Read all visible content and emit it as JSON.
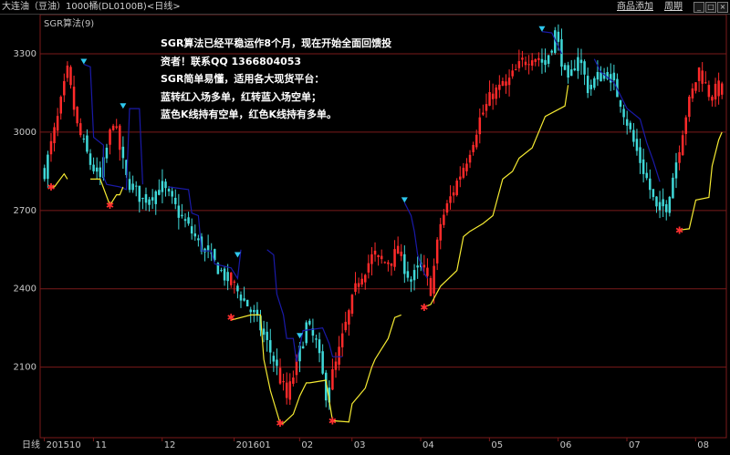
{
  "window": {
    "title": "大连油（豆油）1000桶(DL0100B)<日线>",
    "buttons": {
      "add": "商品添加",
      "period": "周期"
    },
    "winbtns": [
      "_",
      "□",
      "×"
    ]
  },
  "indicator_label": "SGR算法(9)",
  "annotation": [
    "SGR算法已经平稳运作8个月，现在开始全面回馈投",
    "资者！联系QQ 1366804053",
    "SGR简单易懂，适用各大现货平台：",
    "蓝转红入场多单，红转蓝入场空单；",
    "蓝色K线持有空单，红色K线持有多单。"
  ],
  "colors": {
    "up": "#ff2a2a",
    "down": "#3fd8d8",
    "stop_line_down": "#1a1aa8",
    "stop_line_up": "#f5ea32",
    "marker_down": "#2ec8ee",
    "marker_up": "#ff3030",
    "grid": "#7a1a1a",
    "axis": "#7a1a1a"
  },
  "chart_data": {
    "type": "candlestick",
    "y_ticks": [
      2100,
      2400,
      2700,
      3000,
      3300
    ],
    "ylim": [
      1830,
      3450
    ],
    "x_labels": [
      {
        "label": "日线",
        "index": -3
      },
      {
        "label": "201510",
        "index": 1
      },
      {
        "label": "11",
        "index": 16
      },
      {
        "label": "12",
        "index": 37
      },
      {
        "label": "201601",
        "index": 59
      },
      {
        "label": "02",
        "index": 79
      },
      {
        "label": "03",
        "index": 95
      },
      {
        "label": "04",
        "index": 116
      },
      {
        "label": "05",
        "index": 137
      },
      {
        "label": "06",
        "index": 158
      },
      {
        "label": "07",
        "index": 179
      },
      {
        "label": "08",
        "index": 200
      }
    ],
    "anchors": [
      [
        0,
        2850
      ],
      [
        4,
        3050
      ],
      [
        7,
        3230
      ],
      [
        10,
        3020
      ],
      [
        14,
        2880
      ],
      [
        17,
        2820
      ],
      [
        21,
        3050
      ],
      [
        25,
        2820
      ],
      [
        30,
        2740
      ],
      [
        36,
        2790
      ],
      [
        42,
        2670
      ],
      [
        48,
        2560
      ],
      [
        55,
        2450
      ],
      [
        61,
        2360
      ],
      [
        66,
        2250
      ],
      [
        70,
        2130
      ],
      [
        74,
        1980
      ],
      [
        77,
        2110
      ],
      [
        80,
        2260
      ],
      [
        83,
        2190
      ],
      [
        86,
        2000
      ],
      [
        89,
        2110
      ],
      [
        92,
        2260
      ],
      [
        96,
        2440
      ],
      [
        100,
        2520
      ],
      [
        104,
        2500
      ],
      [
        108,
        2540
      ],
      [
        112,
        2430
      ],
      [
        115,
        2490
      ],
      [
        118,
        2400
      ],
      [
        121,
        2650
      ],
      [
        125,
        2780
      ],
      [
        129,
        2900
      ],
      [
        133,
        3050
      ],
      [
        137,
        3150
      ],
      [
        141,
        3180
      ],
      [
        145,
        3250
      ],
      [
        149,
        3300
      ],
      [
        153,
        3260
      ],
      [
        156,
        3380
      ],
      [
        160,
        3180
      ],
      [
        163,
        3300
      ],
      [
        166,
        3170
      ],
      [
        169,
        3210
      ],
      [
        172,
        3230
      ],
      [
        176,
        3120
      ],
      [
        180,
        2960
      ],
      [
        184,
        2820
      ],
      [
        187,
        2700
      ],
      [
        190,
        2720
      ],
      [
        193,
        2890
      ],
      [
        196,
        3070
      ],
      [
        200,
        3240
      ],
      [
        203,
        3150
      ],
      [
        206,
        3160
      ]
    ],
    "down_markers": [
      [
        12,
        3270
      ],
      [
        24,
        3100
      ],
      [
        59,
        2530
      ],
      [
        78,
        2220
      ],
      [
        110,
        2740
      ],
      [
        152,
        3395
      ]
    ],
    "up_markers": [
      [
        2,
        2790
      ],
      [
        20,
        2720
      ],
      [
        57,
        2290
      ],
      [
        72,
        1885
      ],
      [
        88,
        1895
      ],
      [
        116,
        2330
      ],
      [
        194,
        2625
      ]
    ],
    "stop_line_down": [
      [
        12,
        3260
      ],
      [
        14,
        3250
      ],
      [
        15,
        2980
      ],
      [
        18,
        2950
      ],
      [
        18,
        2830
      ],
      [
        19,
        2800
      ],
      [
        23,
        2790
      ],
      [
        25,
        2780
      ],
      [
        26,
        3090
      ],
      [
        29,
        3090
      ],
      [
        30,
        2800
      ],
      [
        38,
        2790
      ],
      [
        44,
        2780
      ],
      [
        45,
        2690
      ],
      [
        47,
        2680
      ],
      [
        48,
        2545
      ],
      [
        51,
        2545
      ],
      [
        52,
        2495
      ],
      [
        57,
        2480
      ],
      [
        59,
        2440
      ],
      [
        60,
        2550
      ],
      [
        68,
        2550
      ],
      [
        70,
        2530
      ],
      [
        71,
        2380
      ],
      [
        73,
        2300
      ],
      [
        74,
        2210
      ],
      [
        76,
        2210
      ],
      [
        77,
        2120
      ],
      [
        79,
        2240
      ],
      [
        85,
        2250
      ],
      [
        87,
        2190
      ],
      [
        88,
        2140
      ],
      [
        91,
        2140
      ],
      [
        110,
        2730
      ],
      [
        112,
        2680
      ],
      [
        113,
        2620
      ],
      [
        114,
        2530
      ],
      [
        116,
        2460
      ],
      [
        117,
        2440
      ],
      [
        152,
        3385
      ],
      [
        155,
        3380
      ],
      [
        158,
        3300
      ],
      [
        168,
        3280
      ],
      [
        170,
        3230
      ],
      [
        174,
        3190
      ],
      [
        178,
        3090
      ],
      [
        182,
        3050
      ],
      [
        184,
        2960
      ],
      [
        186,
        2890
      ],
      [
        188,
        2810
      ]
    ],
    "stop_line_up": [
      [
        2,
        2790
      ],
      [
        3,
        2790
      ],
      [
        6,
        2840
      ],
      [
        7,
        2820
      ],
      [
        14,
        2820
      ],
      [
        17,
        2820
      ],
      [
        20,
        2720
      ],
      [
        22,
        2760
      ],
      [
        23,
        2760
      ],
      [
        24,
        2790
      ],
      [
        57,
        2280
      ],
      [
        63,
        2300
      ],
      [
        66,
        2300
      ],
      [
        67,
        2130
      ],
      [
        69,
        2010
      ],
      [
        72,
        1885
      ],
      [
        73,
        1885
      ],
      [
        76,
        1920
      ],
      [
        78,
        1990
      ],
      [
        80,
        2040
      ],
      [
        81,
        2040
      ],
      [
        86,
        2050
      ],
      [
        88,
        1895
      ],
      [
        93,
        1890
      ],
      [
        94,
        1960
      ],
      [
        96,
        1990
      ],
      [
        98,
        2020
      ],
      [
        100,
        2100
      ],
      [
        101,
        2130
      ],
      [
        103,
        2170
      ],
      [
        105,
        2210
      ],
      [
        107,
        2290
      ],
      [
        109,
        2300
      ],
      [
        116,
        2330
      ],
      [
        118,
        2340
      ],
      [
        121,
        2410
      ],
      [
        126,
        2470
      ],
      [
        128,
        2600
      ],
      [
        130,
        2620
      ],
      [
        134,
        2650
      ],
      [
        137,
        2680
      ],
      [
        140,
        2820
      ],
      [
        143,
        2850
      ],
      [
        145,
        2900
      ],
      [
        149,
        2940
      ],
      [
        153,
        3060
      ],
      [
        159,
        3100
      ],
      [
        160,
        3180
      ],
      [
        194,
        2625
      ],
      [
        197,
        2630
      ],
      [
        199,
        2740
      ],
      [
        203,
        2750
      ],
      [
        204,
        2870
      ],
      [
        206,
        2970
      ],
      [
        207,
        3000
      ]
    ]
  }
}
